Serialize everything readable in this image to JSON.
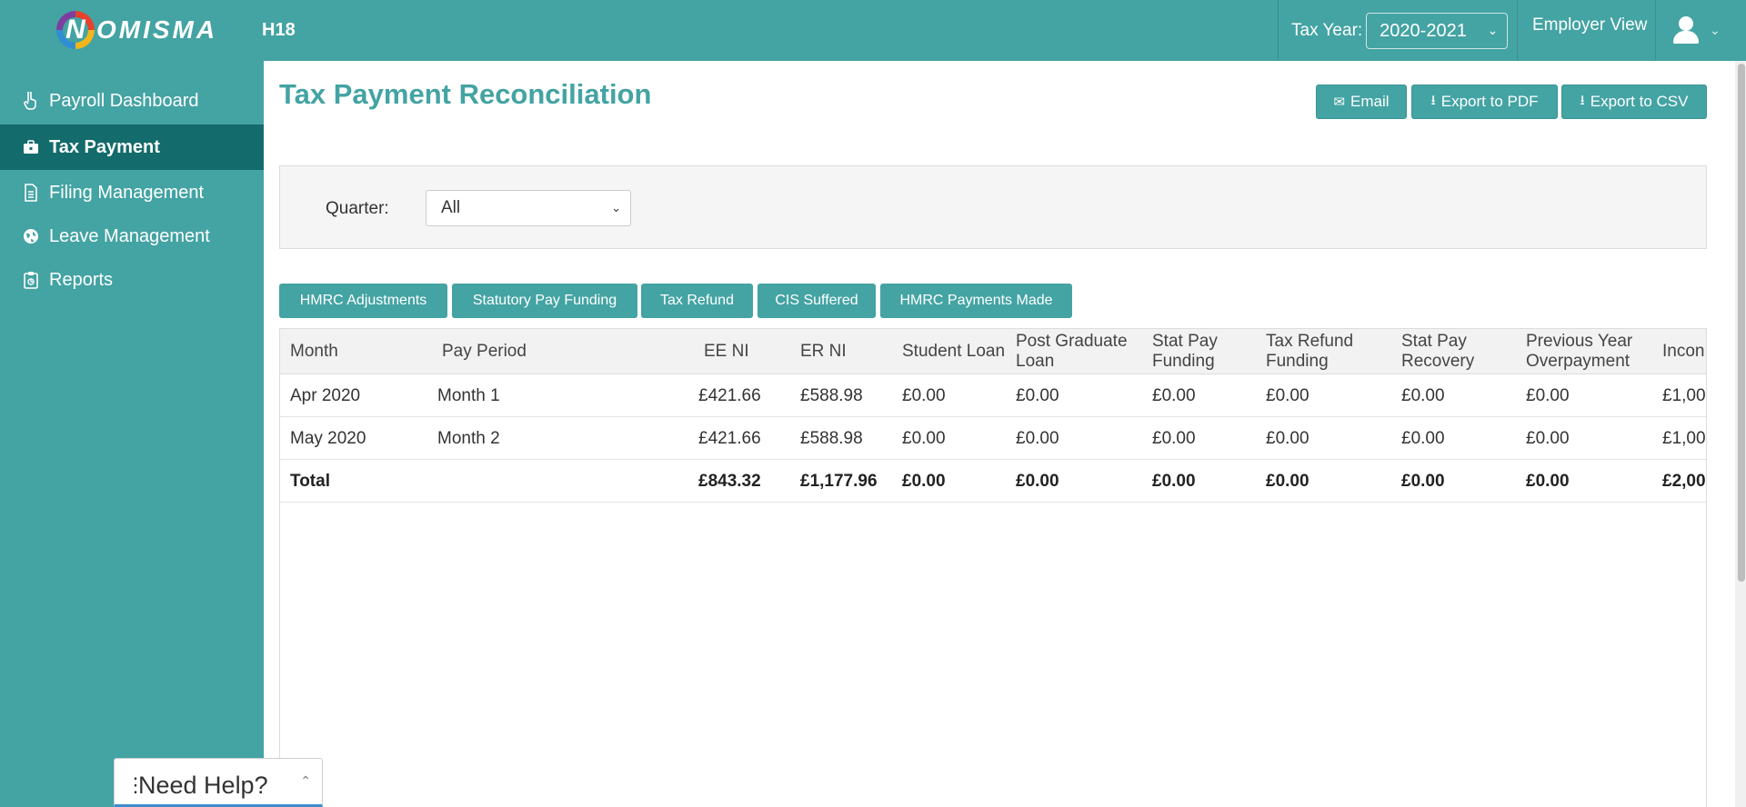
{
  "header": {
    "logo_letter": "N",
    "logo_text": "OMISMA",
    "company": "H18",
    "tax_year_label": "Tax Year:",
    "tax_year_value": "2020-2021",
    "employer_view": "Employer View"
  },
  "sidebar": {
    "items": [
      {
        "label": "Payroll Dashboard",
        "icon": "hand-pointer-icon",
        "active": false
      },
      {
        "label": "Tax Payment",
        "icon": "briefcase-icon",
        "active": true
      },
      {
        "label": "Filing Management",
        "icon": "document-icon",
        "active": false
      },
      {
        "label": "Leave Management",
        "icon": "globe-icon",
        "active": false
      },
      {
        "label": "Reports",
        "icon": "clipboard-icon",
        "active": false
      }
    ]
  },
  "page": {
    "title": "Tax Payment Reconciliation",
    "actions": {
      "email": "Email",
      "export_pdf": "Export to PDF",
      "export_csv": "Export to CSV"
    }
  },
  "filter": {
    "quarter_label": "Quarter:",
    "quarter_value": "All"
  },
  "tabs": [
    "HMRC Adjustments",
    "Statutory Pay Funding",
    "Tax Refund",
    "CIS Suffered",
    "HMRC Payments Made"
  ],
  "table": {
    "columns": [
      [
        "Month"
      ],
      [
        "Pay Period"
      ],
      [
        "EE NI"
      ],
      [
        "ER NI"
      ],
      [
        "Student Loan"
      ],
      [
        "Post Graduate",
        "Loan"
      ],
      [
        "Stat Pay",
        "Funding"
      ],
      [
        "Tax Refund",
        "Funding"
      ],
      [
        "Stat Pay",
        "Recovery"
      ],
      [
        "Previous Year",
        "Overpayment"
      ],
      [
        "Incon"
      ]
    ],
    "rows": [
      [
        "Apr 2020",
        "Month 1",
        "£421.66",
        "£588.98",
        "£0.00",
        "£0.00",
        "£0.00",
        "£0.00",
        "£0.00",
        "£0.00",
        "£1,00"
      ],
      [
        "May 2020",
        "Month 2",
        "£421.66",
        "£588.98",
        "£0.00",
        "£0.00",
        "£0.00",
        "£0.00",
        "£0.00",
        "£0.00",
        "£1,00"
      ]
    ],
    "total": [
      "Total",
      "",
      "£843.32",
      "£1,177.96",
      "£0.00",
      "£0.00",
      "£0.00",
      "£0.00",
      "£0.00",
      "£0.00",
      "£2,00"
    ]
  },
  "help": {
    "label": "Need Help?"
  },
  "colors": {
    "primary": "#44a3a3",
    "sidebar_active": "#146b6b",
    "help_accent": "#3b8fd0"
  }
}
